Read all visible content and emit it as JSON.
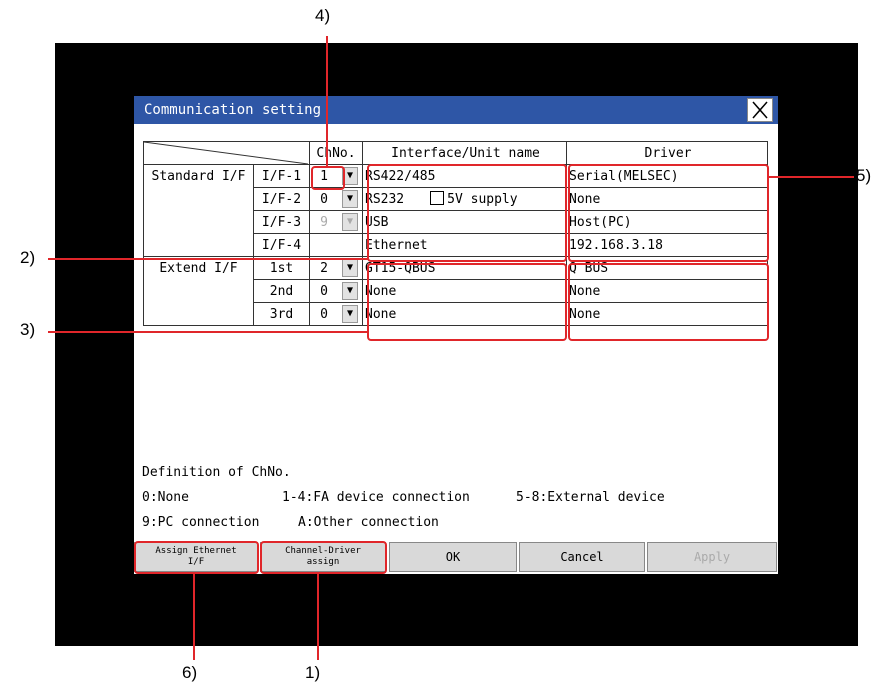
{
  "dialog": {
    "title": "Communication setting"
  },
  "table": {
    "headers": {
      "chno": "ChNo.",
      "interface": "Interface/Unit name",
      "driver": "Driver"
    },
    "groups": {
      "standard": "Standard I/F",
      "extend": "Extend I/F"
    },
    "rows": [
      {
        "slot": "I/F-1",
        "ch": "1",
        "iface": "RS422/485",
        "driver": "Serial(MELSEC)"
      },
      {
        "slot": "I/F-2",
        "ch": "0",
        "iface": "RS232",
        "driver": "None",
        "checkbox_label": "5V supply"
      },
      {
        "slot": "I/F-3",
        "ch": "9",
        "iface": "USB",
        "driver": "Host(PC)"
      },
      {
        "slot": "I/F-4",
        "ch": "",
        "iface": "Ethernet",
        "driver": "192.168.3.18"
      },
      {
        "slot": "1st",
        "ch": "2",
        "iface": "GT15-QBUS",
        "driver": "Q BUS"
      },
      {
        "slot": "2nd",
        "ch": "0",
        "iface": "None",
        "driver": "None"
      },
      {
        "slot": "3rd",
        "ch": "0",
        "iface": "None",
        "driver": "None"
      }
    ]
  },
  "definitions": {
    "title": "Definition of ChNo.",
    "line1a": "0:None",
    "line1b": "1-4:FA device connection",
    "line1c": "5-8:External device",
    "line2a": "9:PC connection",
    "line2b": "A:Other connection"
  },
  "buttons": {
    "assign_ethernet_1": "Assign Ethernet",
    "assign_ethernet_2": "I/F",
    "channel_driver_1": "Channel-Driver",
    "channel_driver_2": "assign",
    "ok": "OK",
    "cancel": "Cancel",
    "apply": "Apply"
  },
  "callouts": {
    "c1": "1)",
    "c2": "2)",
    "c3": "3)",
    "c4": "4)",
    "c5": "5)",
    "c6": "6)"
  },
  "colors": {
    "titlebar": "#2e56a6",
    "highlight": "#e0262a",
    "frame": "#000000"
  }
}
